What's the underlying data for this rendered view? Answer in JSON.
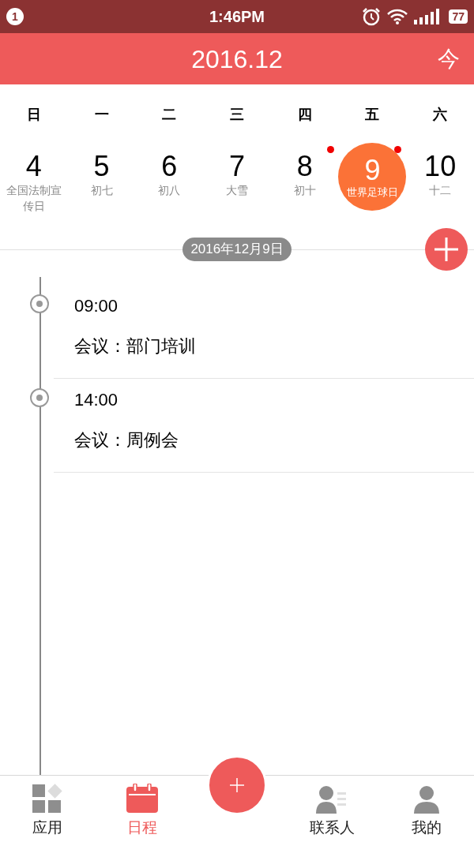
{
  "status_bar": {
    "notification_count": "1",
    "time": "1:46PM",
    "battery": "77"
  },
  "header": {
    "title": "2016.12",
    "today_button": "今"
  },
  "weekdays": [
    "日",
    "一",
    "二",
    "三",
    "四",
    "五",
    "六"
  ],
  "days": [
    {
      "number": "4",
      "label": "全国法制宣传日",
      "selected": false,
      "has_event": false
    },
    {
      "number": "5",
      "label": "初七",
      "selected": false,
      "has_event": false
    },
    {
      "number": "6",
      "label": "初八",
      "selected": false,
      "has_event": false
    },
    {
      "number": "7",
      "label": "大雪",
      "selected": false,
      "has_event": false
    },
    {
      "number": "8",
      "label": "初十",
      "selected": false,
      "has_event": true
    },
    {
      "number": "9",
      "label": "世界足球日",
      "selected": true,
      "has_event": true
    },
    {
      "number": "10",
      "label": "十二",
      "selected": false,
      "has_event": false
    }
  ],
  "date_pill": "2016年12月9日",
  "events": [
    {
      "time": "09:00",
      "title": "会议：部门培训"
    },
    {
      "time": "14:00",
      "title": "会议：周例会"
    }
  ],
  "nav": [
    {
      "label": "应用",
      "kind": "apps",
      "selected": false
    },
    {
      "label": "日程",
      "kind": "calendar",
      "selected": true
    },
    {
      "kind": "fab"
    },
    {
      "label": "联系人",
      "kind": "contacts",
      "selected": false
    },
    {
      "label": "我的",
      "kind": "person",
      "selected": false
    }
  ]
}
